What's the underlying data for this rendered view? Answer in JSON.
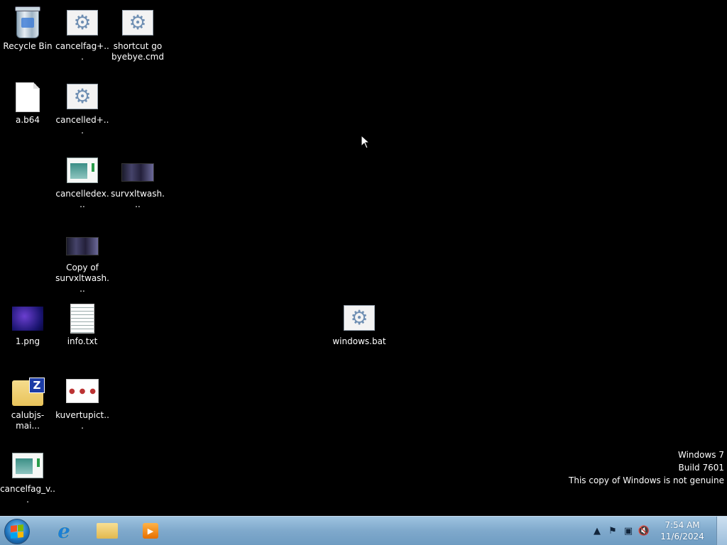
{
  "desktop": {
    "icons": {
      "recycle_bin": "Recycle Bin",
      "cancelfag": "cancelfag+...",
      "shortcut": "shortcut go byebye.cmd",
      "a_b64": "a.b64",
      "cancelled": "cancelled+...",
      "cancelledex": "cancelledex...",
      "survx1": "survxltwash...",
      "copy_survx": "Copy of survxltwash...",
      "png1": "1.png",
      "info": "info.txt",
      "windows_bat": "windows.bat",
      "calubjs": "calubjs-mai...",
      "kuvertu": "kuvertupict...",
      "cancelfag_v": "cancelfag_v..."
    }
  },
  "watermark": {
    "line1": "Windows 7",
    "line2": "Build 7601",
    "line3": "This copy of Windows is not genuine"
  },
  "taskbar": {
    "clock_time": "7:54 AM",
    "clock_date": "11/6/2024",
    "tray_icons": [
      "show-hidden-icons",
      "action-center-flag",
      "network-icon",
      "volume-muted-icon"
    ]
  }
}
